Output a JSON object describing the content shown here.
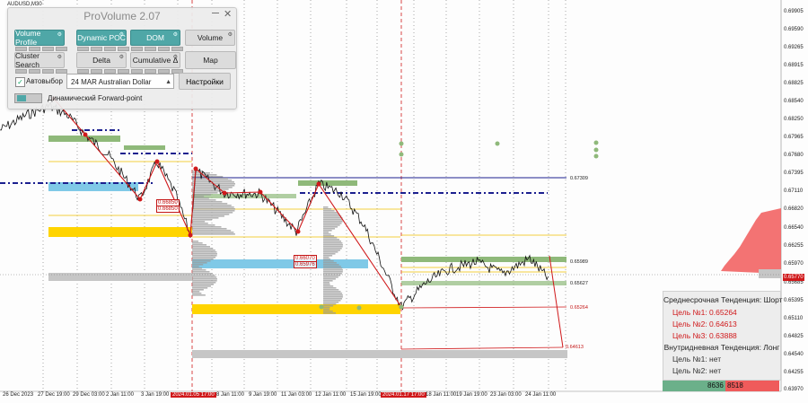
{
  "chart": {
    "symbol": "AUDUSD,M30",
    "current_price": "0.65770",
    "price_ticks": [
      "0.69905",
      "0.69590",
      "0.69265",
      "0.68915",
      "0.68825",
      "0.68540",
      "0.68250",
      "0.67965",
      "0.67680",
      "0.67395",
      "0.67110",
      "0.66820",
      "0.66540",
      "0.66255",
      "0.65970",
      "0.65685",
      "0.65395",
      "0.65110",
      "0.64825",
      "0.64540",
      "0.64255",
      "0.63970"
    ],
    "time_labels": [
      {
        "text": "26 Dec 2023",
        "highlight": false
      },
      {
        "text": "27 Dec 19:00",
        "highlight": false
      },
      {
        "text": "29 Dec 03:00",
        "highlight": false
      },
      {
        "text": "2 Jan 11:00",
        "highlight": false
      },
      {
        "text": "3 Jan 19:00",
        "highlight": false
      },
      {
        "text": "2024.01.05 17:00",
        "highlight": true
      },
      {
        "text": "8 Jan 11:00",
        "highlight": false
      },
      {
        "text": "9 Jan 19:00",
        "highlight": false
      },
      {
        "text": "11 Jan 03:00",
        "highlight": false
      },
      {
        "text": "12 Jan 11:00",
        "highlight": false
      },
      {
        "text": "15 Jan 19:00",
        "highlight": false
      },
      {
        "text": "2024.01.17 17:00",
        "highlight": true
      },
      {
        "text": "18 Jan 11:00",
        "highlight": false
      },
      {
        "text": "19 Jan 19:00",
        "highlight": false
      },
      {
        "text": "23 Jan 03:00",
        "highlight": false
      },
      {
        "text": "24 Jan 11:00",
        "highlight": false
      }
    ],
    "level_labels": {
      "l1": "0.67309",
      "l2": "0.65989",
      "l3": "0.65627",
      "l4": "0.65264",
      "l5": "0.64613"
    },
    "box_labels": {
      "b1": "0.66850",
      "b2": "0.66850",
      "b3": "0.66070",
      "b4": "0.65976"
    },
    "colors": {
      "bearish_trend": "#d0191b",
      "navy_dash": "#1b1f8f",
      "volume_gold": "#ffd400",
      "volume_gray": "#c6c6c6",
      "volume_sky": "#7fc9e7",
      "volume_green": "#8fb97a",
      "profile_red": "#f15a5a"
    }
  },
  "provolume": {
    "title": "ProVolume 2.07",
    "buttons": {
      "volume_profile": "Volume Profile",
      "dynamic_poc": "Dynamic POC",
      "dom": "DOM",
      "volume": "Volume",
      "cluster_search": "Cluster Search",
      "delta": "Delta",
      "cumulative_delta": "Cumulative Δ",
      "map": "Map"
    },
    "auto_select_label": "Автовыбор",
    "auto_select_checked": true,
    "instrument_select": "24 MAR Australian Dollar",
    "settings_button": "Настройки",
    "forward_point_label": "Динамический Forward-point"
  },
  "trend_panel": {
    "medium_term": "Среднесрочная Тенденция: Шорт",
    "target1": "Цель №1: 0.65264",
    "target2": "Цель №2: 0.64613",
    "target3": "Цель №3: 0.63888",
    "intraday": "Внутридневная Тенденция: Лонг",
    "intraday_target1": "Цель №1: нет",
    "intraday_target2": "Цель №2: нет"
  },
  "volume_bar": {
    "buy": "8636",
    "sell": "8518"
  }
}
